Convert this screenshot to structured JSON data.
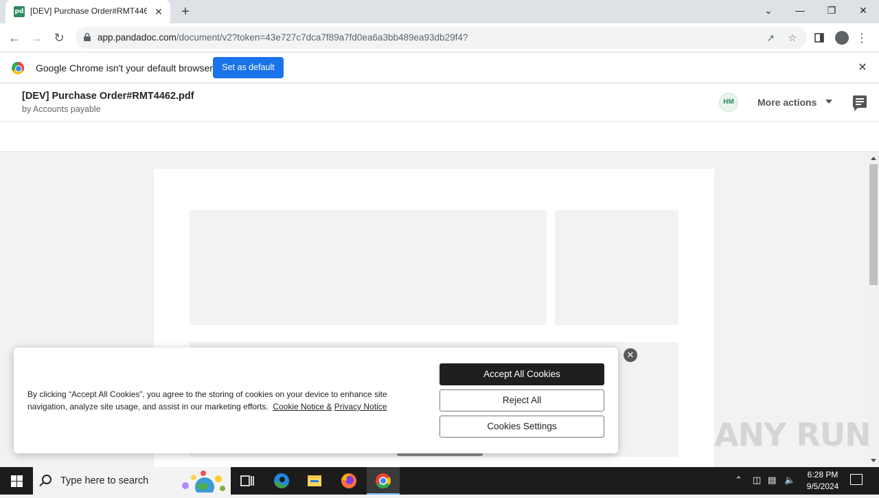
{
  "browser": {
    "tab": {
      "title": "[DEV] Purchase Order#RMT4462.pdf",
      "favicon": "pd",
      "close": "✕"
    },
    "new_tab": "+",
    "window_controls": {
      "tabs_dropdown": "⌄",
      "minimize": "—",
      "restore": "❐",
      "close": "✕"
    },
    "address": {
      "host": "app.pandadoc.com",
      "path": "/document/v2?token=43e727c7dca7f89a7fd0ea6a3bb489ea93db29f4?"
    },
    "infobar": {
      "message": "Google Chrome isn't your default browser",
      "button": "Set as default",
      "close": "✕"
    }
  },
  "document": {
    "title": "[DEV] Purchase Order#RMT4462.pdf",
    "by": "by Accounts payable",
    "avatar_initials": "HM",
    "more_actions": "More actions"
  },
  "cookie_banner": {
    "text": "By clicking “Accept All Cookies”, you agree to the storing of cookies on your device to enhance site navigation, analyze site usage, and assist in our marketing efforts.",
    "cookie_notice_link": "Cookie Notice &",
    "privacy_notice_link": "Privacy Notice",
    "accept_all": "Accept All Cookies",
    "reject_all": "Reject All",
    "settings": "Cookies Settings",
    "close": "✕"
  },
  "watermark": "ANY RUN",
  "taskbar": {
    "search_placeholder": "Type here to search",
    "clock_time": "6:28 PM",
    "clock_date": "9/5/2024"
  },
  "colors": {
    "brand_green": "#2e8a5f",
    "chrome_blue": "#1a73e8",
    "accept_dark": "#1f1f1f"
  }
}
